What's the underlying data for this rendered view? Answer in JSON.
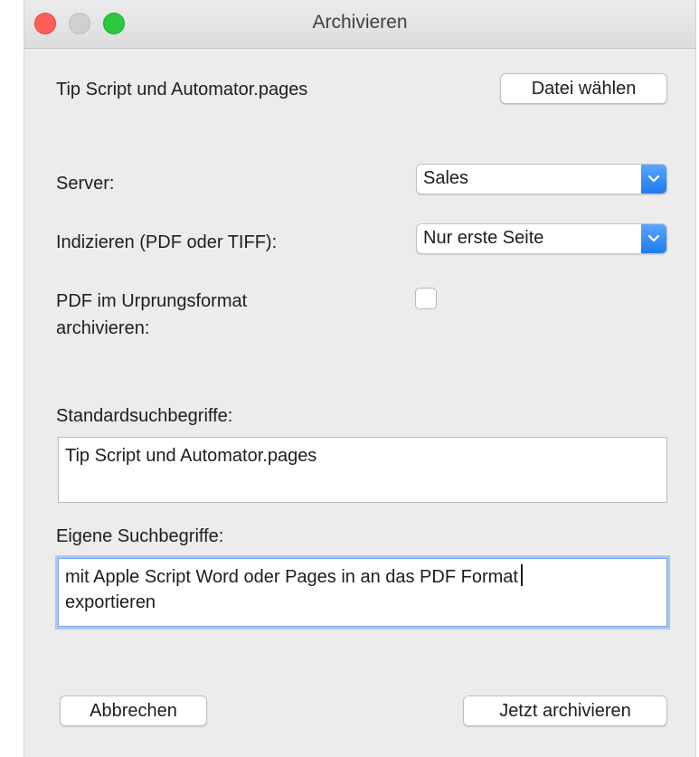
{
  "window": {
    "title": "Archivieren"
  },
  "file": {
    "name": "Tip Script und Automator.pages",
    "choose_button": "Datei wählen"
  },
  "server": {
    "label": "Server:",
    "selected": "Sales"
  },
  "indexing": {
    "label": "Indizieren (PDF oder TIFF):",
    "selected": "Nur erste Seite"
  },
  "pdf_original": {
    "label_line1": "PDF im Urprungsformat",
    "label_line2": "archivieren:",
    "checked": false
  },
  "standard_terms": {
    "label": "Standardsuchbegriffe:",
    "value": "Tip Script und Automator.pages"
  },
  "custom_terms": {
    "label": "Eigene Suchbegriffe:",
    "line1": "mit Apple Script Word oder Pages in an das PDF Format",
    "line2": "exportieren"
  },
  "footer": {
    "cancel_label": "Abbrechen",
    "archive_label": "Jetzt archivieren"
  },
  "colors": {
    "accent": "#1e7bf0",
    "focus_ring": "#a9c6f3",
    "close": "#fc5f57",
    "zoom": "#2bc840"
  }
}
